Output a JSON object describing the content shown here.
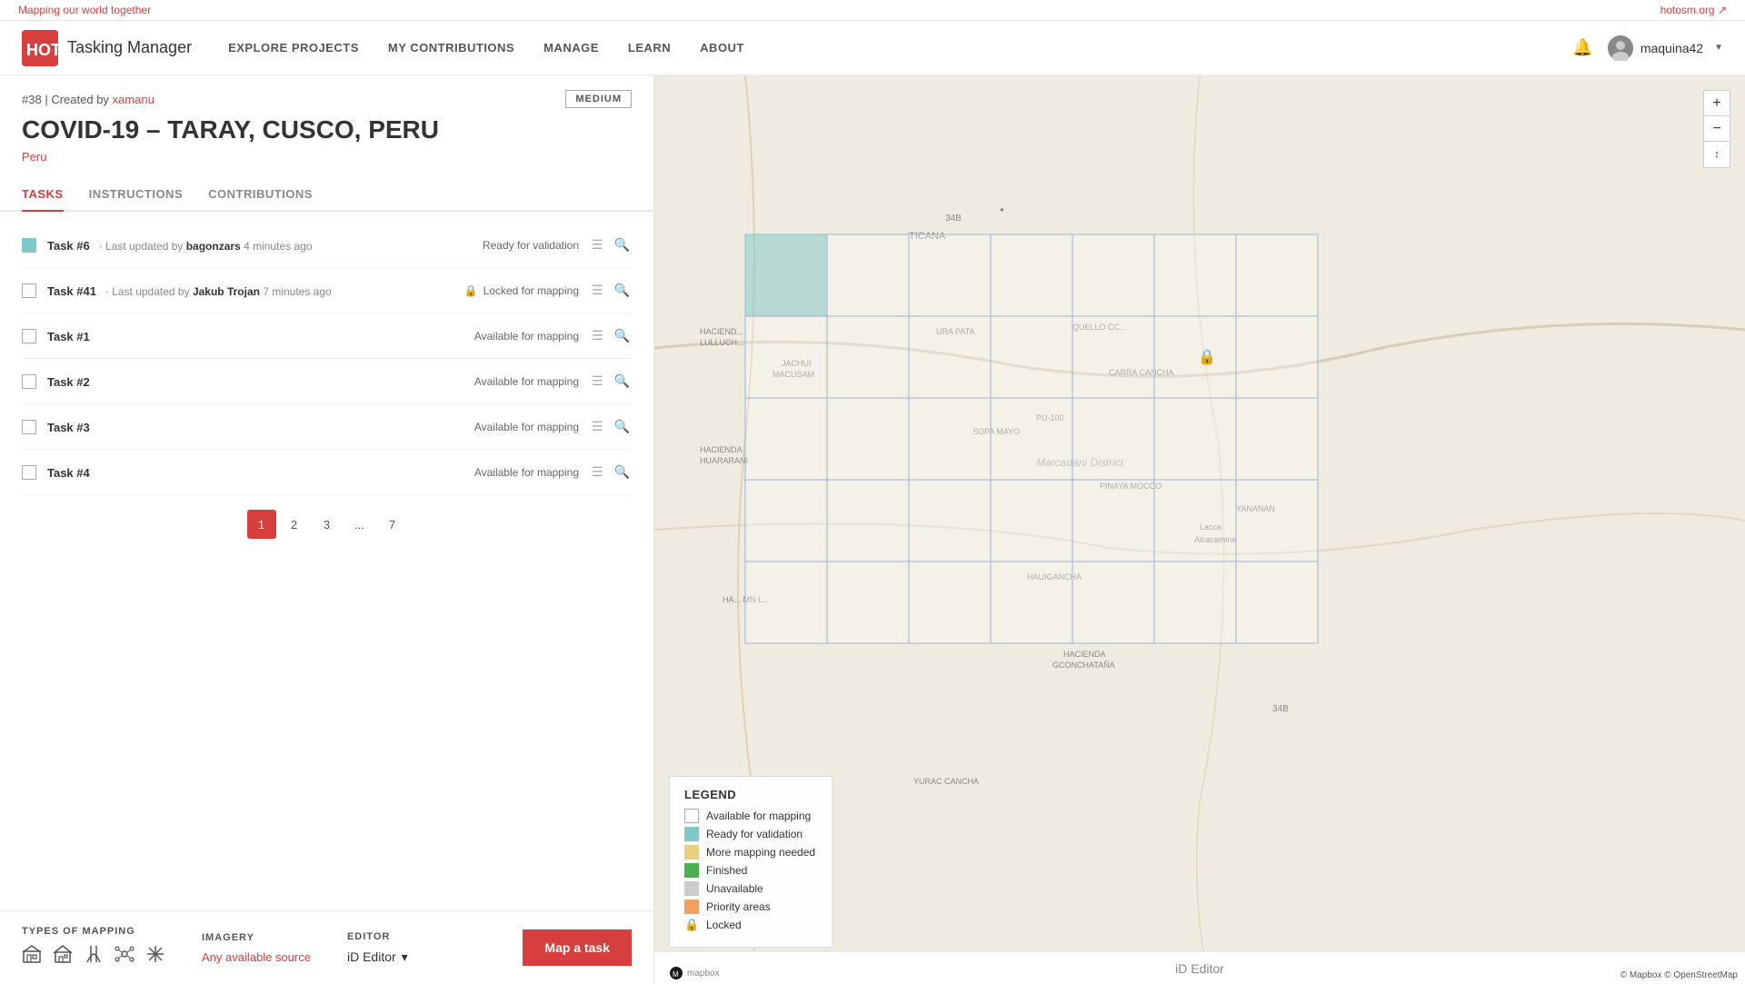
{
  "topBanner": {
    "left": "Mapping our world together",
    "right": "hotosm.org ↗"
  },
  "navbar": {
    "brandName": "Tasking Manager",
    "links": [
      {
        "id": "explore",
        "label": "EXPLORE PROJECTS"
      },
      {
        "id": "contributions",
        "label": "MY CONTRIBUTIONS"
      },
      {
        "id": "manage",
        "label": "MANAGE"
      },
      {
        "id": "learn",
        "label": "LEARN"
      },
      {
        "id": "about",
        "label": "ABOUT"
      }
    ],
    "username": "maquina42"
  },
  "project": {
    "id": "#38",
    "createdBy": "Created by",
    "author": "xamanu",
    "difficulty": "MEDIUM",
    "title": "COVID-19 – TARAY, CUSCO, PERU",
    "country": "Peru"
  },
  "tabs": [
    {
      "id": "tasks",
      "label": "TASKS",
      "active": true
    },
    {
      "id": "instructions",
      "label": "INSTRUCTIONS",
      "active": false
    },
    {
      "id": "contributions",
      "label": "CONTRIBUTIONS",
      "active": false
    }
  ],
  "tasks": [
    {
      "id": "Task #6",
      "hasUpdate": true,
      "updatedBy": "bagonzars",
      "updatedAgo": "4 minutes ago",
      "status": "Ready for validation",
      "statusType": "validation",
      "locked": false
    },
    {
      "id": "Task #41",
      "hasUpdate": true,
      "updatedBy": "Jakub Trojan",
      "updatedAgo": "7 minutes ago",
      "status": "Locked for mapping",
      "statusType": "locked",
      "locked": true
    },
    {
      "id": "Task #1",
      "hasUpdate": false,
      "updatedBy": "",
      "updatedAgo": "",
      "status": "Available for mapping",
      "statusType": "available",
      "locked": false
    },
    {
      "id": "Task #2",
      "hasUpdate": false,
      "updatedBy": "",
      "updatedAgo": "",
      "status": "Available for mapping",
      "statusType": "available",
      "locked": false
    },
    {
      "id": "Task #3",
      "hasUpdate": false,
      "updatedBy": "",
      "updatedAgo": "",
      "status": "Available for mapping",
      "statusType": "available",
      "locked": false
    },
    {
      "id": "Task #4",
      "hasUpdate": false,
      "updatedBy": "",
      "updatedAgo": "",
      "status": "Available for mapping",
      "statusType": "available",
      "locked": false
    }
  ],
  "pagination": {
    "pages": [
      "1",
      "2",
      "3",
      "...",
      "7"
    ],
    "activePage": "1"
  },
  "bottomBar": {
    "typesTitle": "TYPES OF MAPPING",
    "imageryTitle": "IMAGERY",
    "imageryValue": "Any available source",
    "editorTitle": "EDITOR",
    "editorValue": "iD Editor",
    "mapTaskBtn": "Map a task"
  },
  "legend": {
    "title": "LEGEND",
    "items": [
      {
        "label": "Available for mapping",
        "color": "#ffffff",
        "border": "#aaa"
      },
      {
        "label": "Ready for validation",
        "color": "#7ec8c8",
        "border": "#7ec8c8"
      },
      {
        "label": "More mapping needed",
        "color": "#e8d080",
        "border": "#e8d080"
      },
      {
        "label": "Finished",
        "color": "#4caf50",
        "border": "#4caf50"
      },
      {
        "label": "Unavailable",
        "color": "#cccccc",
        "border": "#cccccc"
      },
      {
        "label": "Priority areas",
        "color": "#f0a060",
        "border": "#f0a060"
      },
      {
        "label": "Locked",
        "color": null,
        "border": null,
        "icon": "🔒"
      }
    ]
  },
  "mapAttribution": "© Mapbox © OpenStreetMap",
  "idEditorFooter": "iD Editor"
}
